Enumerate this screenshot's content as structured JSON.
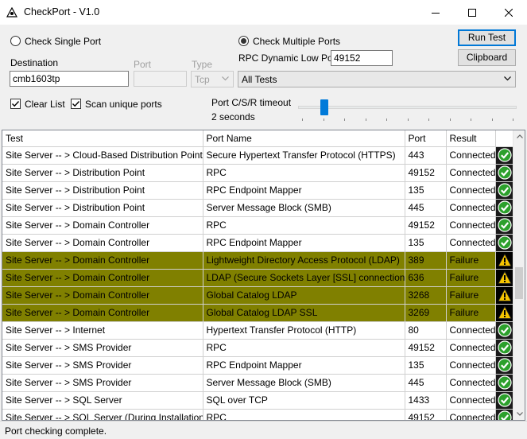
{
  "window": {
    "title": "CheckPort  - V1.0"
  },
  "mode": {
    "single_label": "Check Single Port",
    "multiple_label": "Check Multiple Ports",
    "selected": "multiple"
  },
  "single": {
    "destination_label": "Destination",
    "destination_value": "cmb1603tp",
    "port_label": "Port",
    "port_value": "",
    "type_label": "Type",
    "type_value": "Tcp"
  },
  "multiple": {
    "rpc_label": "RPC Dynamic Low Port",
    "rpc_value": "49152",
    "tests_value": "All Tests"
  },
  "buttons": {
    "run_test": "Run Test",
    "clipboard": "Clipboard"
  },
  "options": {
    "clear_list_label": "Clear List",
    "clear_list_checked": true,
    "scan_unique_label": "Scan unique ports",
    "scan_unique_checked": true
  },
  "timeout": {
    "label": "Port C/S/R timeout",
    "value_text": "2 seconds",
    "level_fraction": 0.12
  },
  "grid": {
    "columns": [
      "Test",
      "Port Name",
      "Port",
      "Result"
    ],
    "rows": [
      {
        "test": "Site Server -- > Cloud-Based Distribution Point",
        "port_name": "Secure Hypertext Transfer Protocol (HTTPS)",
        "port": "443",
        "result": "Connected",
        "status": "ok"
      },
      {
        "test": "Site Server -- > Distribution Point",
        "port_name": "RPC",
        "port": "49152",
        "result": "Connected",
        "status": "ok"
      },
      {
        "test": "Site Server -- > Distribution Point",
        "port_name": "RPC Endpoint Mapper",
        "port": "135",
        "result": "Connected",
        "status": "ok"
      },
      {
        "test": "Site Server -- > Distribution Point",
        "port_name": "Server Message Block (SMB)",
        "port": "445",
        "result": "Connected",
        "status": "ok"
      },
      {
        "test": "Site Server -- > Domain Controller",
        "port_name": "RPC",
        "port": "49152",
        "result": "Connected",
        "status": "ok"
      },
      {
        "test": "Site Server -- > Domain Controller",
        "port_name": "RPC Endpoint Mapper",
        "port": "135",
        "result": "Connected",
        "status": "ok"
      },
      {
        "test": "Site Server -- > Domain Controller",
        "port_name": "Lightweight Directory Access Protocol (LDAP)",
        "port": "389",
        "result": "Failure",
        "status": "warn"
      },
      {
        "test": "Site Server -- > Domain Controller",
        "port_name": "LDAP (Secure Sockets Layer [SSL] connection)",
        "port": "636",
        "result": "Failure",
        "status": "warn"
      },
      {
        "test": "Site Server -- > Domain Controller",
        "port_name": "Global Catalog LDAP",
        "port": "3268",
        "result": "Failure",
        "status": "warn"
      },
      {
        "test": "Site Server -- > Domain Controller",
        "port_name": "Global Catalog LDAP SSL",
        "port": "3269",
        "result": "Failure",
        "status": "warn"
      },
      {
        "test": "Site Server -- > Internet",
        "port_name": "Hypertext Transfer Protocol (HTTP)",
        "port": "80",
        "result": "Connected",
        "status": "ok"
      },
      {
        "test": "Site Server -- > SMS Provider",
        "port_name": "RPC",
        "port": "49152",
        "result": "Connected",
        "status": "ok"
      },
      {
        "test": "Site Server -- > SMS Provider",
        "port_name": "RPC Endpoint Mapper",
        "port": "135",
        "result": "Connected",
        "status": "ok"
      },
      {
        "test": "Site Server -- > SMS Provider",
        "port_name": "Server Message Block (SMB)",
        "port": "445",
        "result": "Connected",
        "status": "ok"
      },
      {
        "test": "Site Server -- > SQL Server",
        "port_name": "SQL over TCP",
        "port": "1433",
        "result": "Connected",
        "status": "ok"
      },
      {
        "test": "Site Server -- > SQL Server (During Installation)",
        "port_name": "RPC",
        "port": "49152",
        "result": "Connected",
        "status": "ok"
      }
    ]
  },
  "colors": {
    "failure_row": "#808000",
    "ok_icon": "#2ca02c",
    "warn_icon": "#f5c400",
    "accent": "#0078d7"
  },
  "icons": {
    "ok": "check-circle-icon",
    "warn": "warning-triangle-icon"
  },
  "status": {
    "text": "Port checking complete."
  }
}
